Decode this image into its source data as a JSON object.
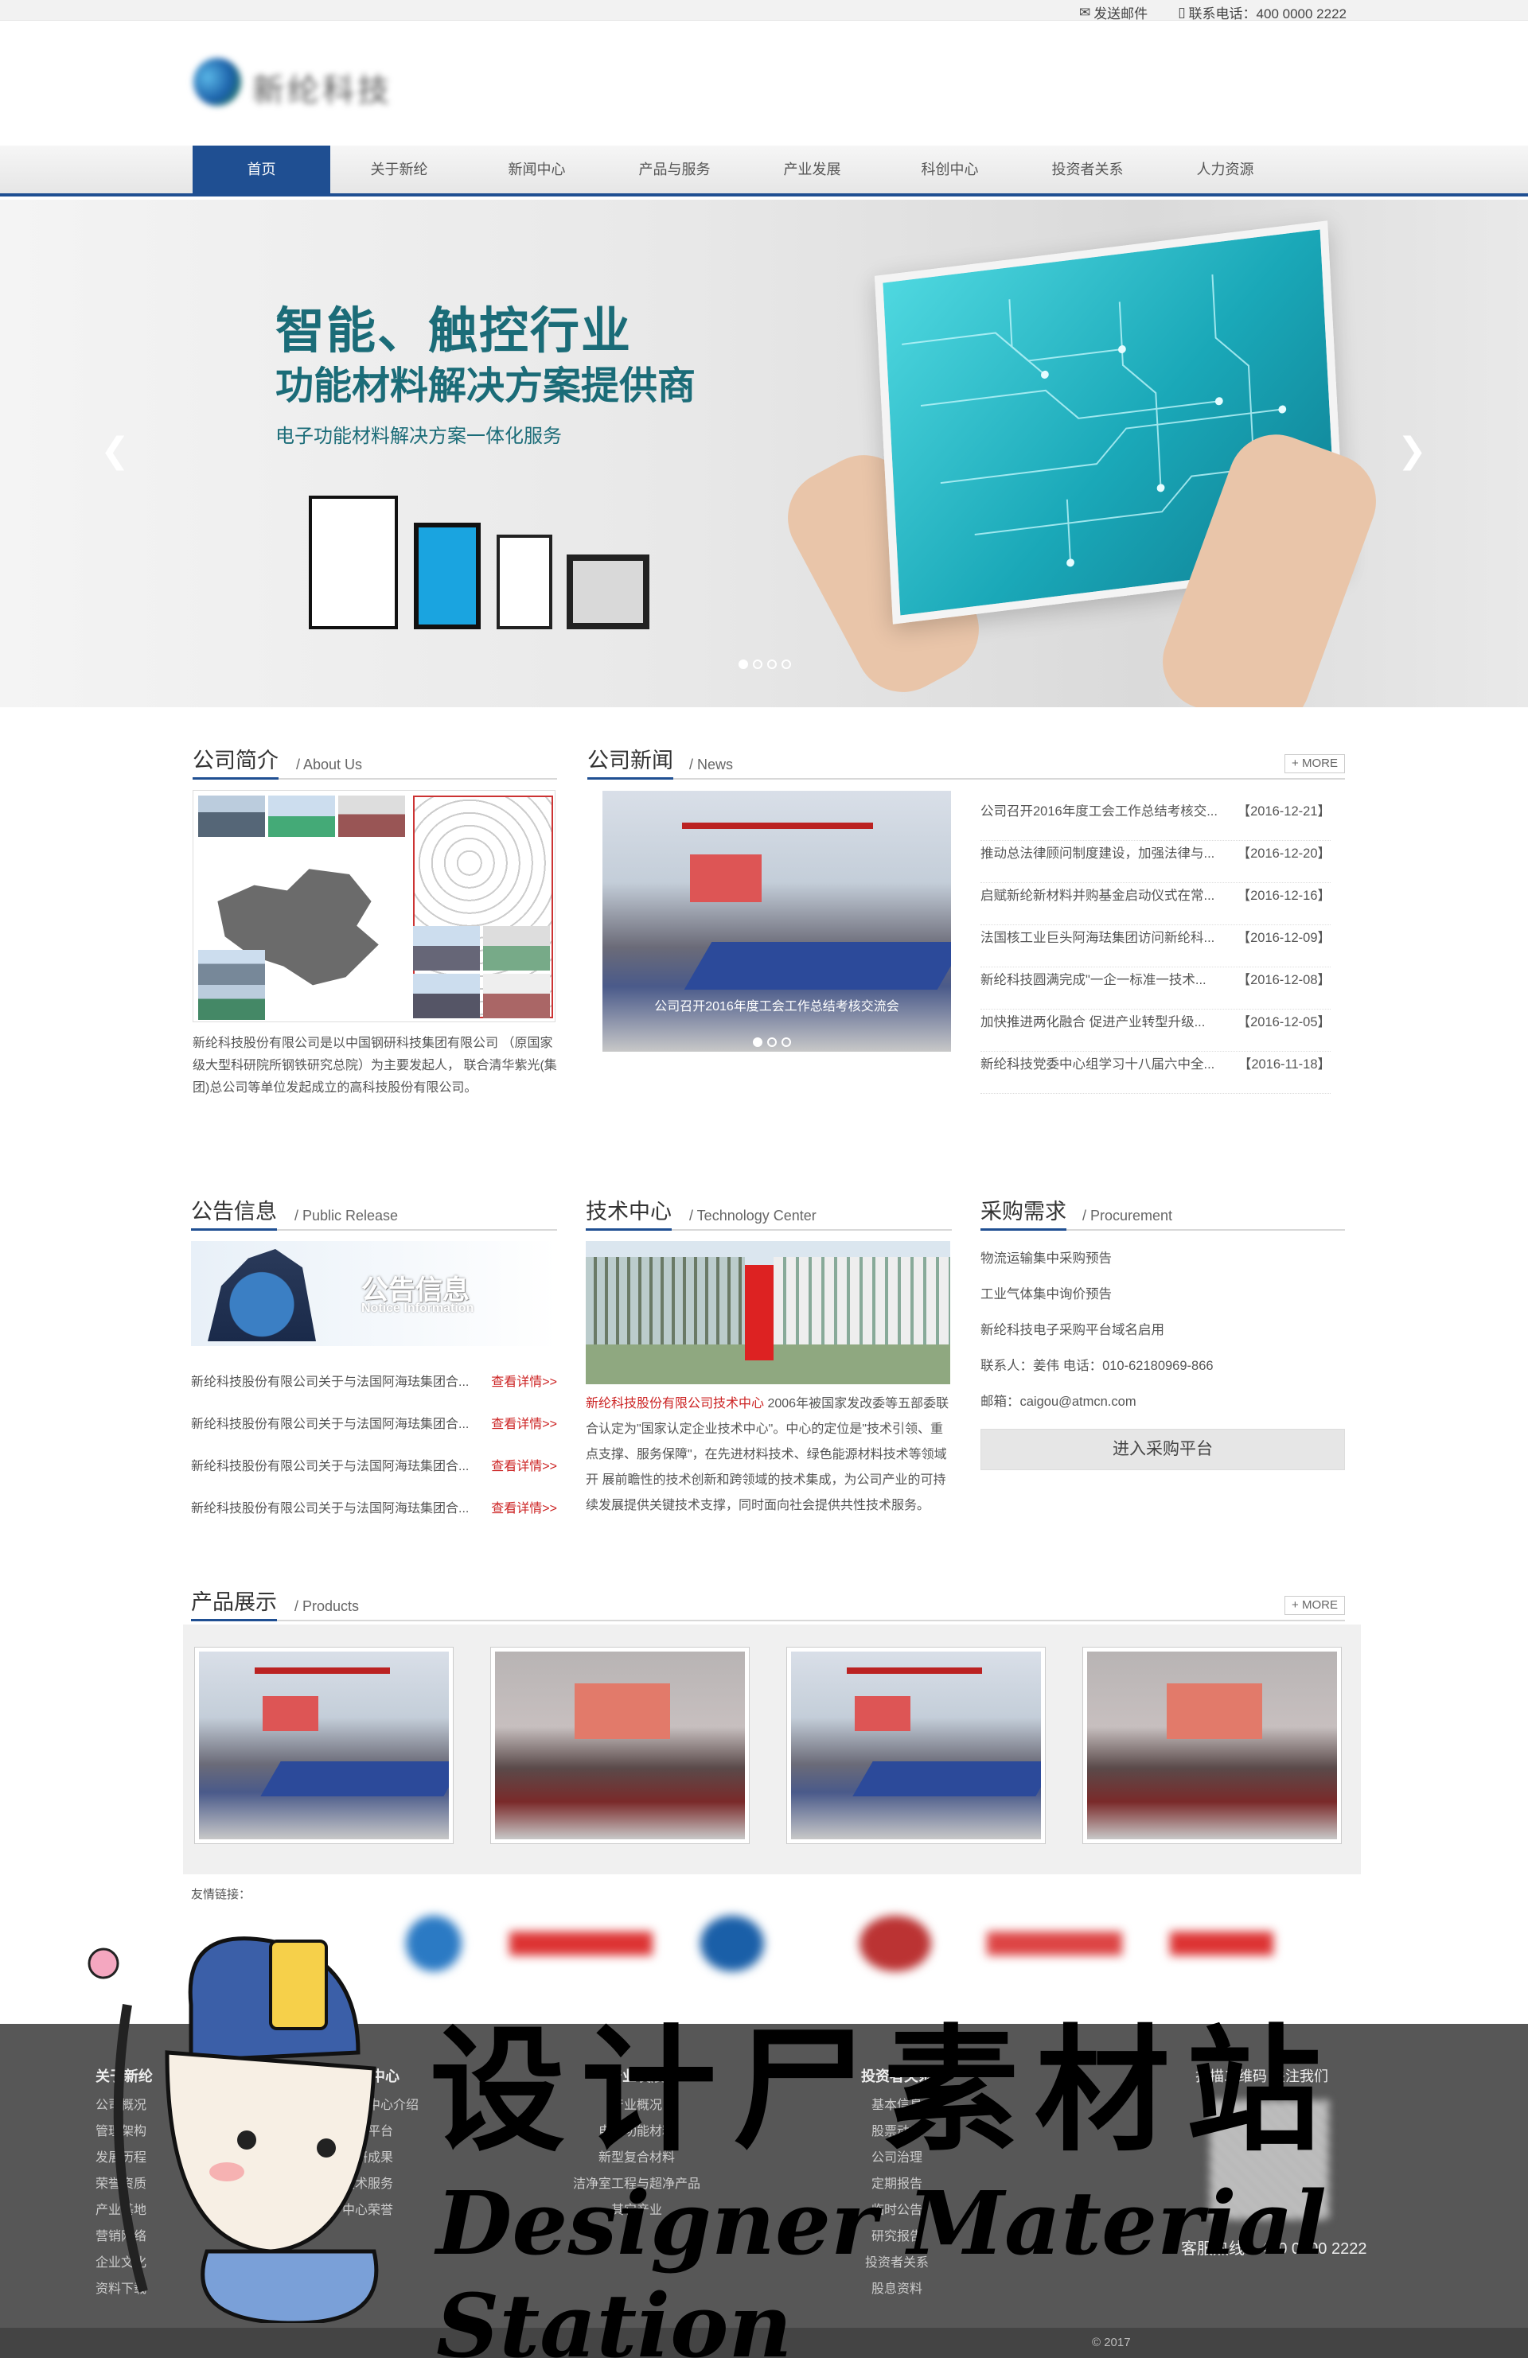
{
  "topbar": {
    "email_label": "发送邮件",
    "phone_label": "联系电话：400 0000 2222"
  },
  "nav": {
    "items": [
      "首页",
      "关于新纶",
      "新闻中心",
      "产品与服务",
      "产业发展",
      "科创中心",
      "投资者关系",
      "人力资源"
    ]
  },
  "banner": {
    "title_line1": "智能、触控行业",
    "title_line2": "功能材料解决方案提供商",
    "subtitle": "电子功能材料解决方案一体化服务"
  },
  "about": {
    "title": "公司简介",
    "subtitle": "/ About Us",
    "text": "新纶科技股份有限公司是以中国钢研科技集团有限公司 （原国家级大型科研院所钢铁研究总院）为主要发起人， 联合清华紫光(集团)总公司等单位发起成立的高科技股份有限公司。"
  },
  "news": {
    "title": "公司新闻",
    "subtitle": "/ News",
    "more": "+ MORE",
    "caption": "公司召开2016年度工会工作总结考核交流会",
    "items": [
      {
        "title": "公司召开2016年度工会工作总结考核交...",
        "date": "【2016-12-21】"
      },
      {
        "title": "推动总法律顾问制度建设，加强法律与...",
        "date": "【2016-12-20】"
      },
      {
        "title": "启赋新纶新材料并购基金启动仪式在常...",
        "date": "【2016-12-16】"
      },
      {
        "title": "法国核工业巨头阿海珐集团访问新纶科...",
        "date": "【2016-12-09】"
      },
      {
        "title": "新纶科技圆满完成\"一企一标准一技术...",
        "date": "【2016-12-08】"
      },
      {
        "title": "加快推进两化融合 促进产业转型升级...",
        "date": "【2016-12-05】"
      },
      {
        "title": "新纶科技党委中心组学习十八届六中全...",
        "date": "【2016-11-18】"
      }
    ]
  },
  "public": {
    "title": "公告信息",
    "subtitle": "/ Public Release",
    "image_text": "公告信息",
    "image_text_en": "Notice Information",
    "items": [
      {
        "title": "新纶科技股份有限公司关于与法国阿海珐集团合...",
        "link": "查看详情>>"
      },
      {
        "title": "新纶科技股份有限公司关于与法国阿海珐集团合...",
        "link": "查看详情>>"
      },
      {
        "title": "新纶科技股份有限公司关于与法国阿海珐集团合...",
        "link": "查看详情>>"
      },
      {
        "title": "新纶科技股份有限公司关于与法国阿海珐集团合...",
        "link": "查看详情>>"
      }
    ]
  },
  "tech": {
    "title": "技术中心",
    "subtitle": "/ Technology Center",
    "highlight": "新纶科技股份有限公司技术中心",
    "text": "2006年被国家发改委等五部委联合认定为\"国家认定企业技术中心\"。中心的定位是\"技术引领、重点支撑、服务保障\"，在先进材料技术、绿色能源材料技术等领域开 展前瞻性的技术创新和跨领域的技术集成，为公司产业的可持续发展提供关键技术支撑，同时面向社会提供共性技术服务。"
  },
  "procurement": {
    "title": "采购需求",
    "subtitle": "/ Procurement",
    "items": [
      "物流运输集中采购预告",
      "工业气体集中询价预告",
      "新纶科技电子采购平台域名启用",
      "联系人：姜伟 电话：010-62180969-866",
      "邮箱：caigou@atmcn.com"
    ],
    "button": "进入采购平台"
  },
  "products": {
    "title": "产品展示",
    "subtitle": "/ Products",
    "more": "+ MORE"
  },
  "links": {
    "label": "友情链接："
  },
  "footer": {
    "columns": [
      {
        "title": "关于新纶",
        "items": [
          "公司概况",
          "管理架构",
          "发展历程",
          "荣誉资质",
          "产业基地",
          "营销网络",
          "企业文化",
          "资料下载"
        ]
      },
      {
        "title": "科创中心",
        "items": [
          "科创中心介绍",
          "研发平台",
          "科研成果",
          "技术服务",
          "中心荣誉"
        ]
      },
      {
        "title": "产业发展",
        "items": [
          "产业概况",
          "电子功能材料",
          "新型复合材料",
          "洁净室工程与超净产品",
          "其它产业"
        ]
      },
      {
        "title": "投资者关系",
        "items": [
          "基本信息",
          "股票动态",
          "公司治理",
          "定期报告",
          "临时公告",
          "研究报告",
          "投资者关系",
          "股息资料"
        ]
      }
    ],
    "qr_title": "扫描二维码 关注我们",
    "tel": "客服热线：400 0000 2222",
    "copyright": "© 2017"
  },
  "watermark": {
    "cn": "设计尸素材站",
    "en": "Designer Material Station"
  }
}
